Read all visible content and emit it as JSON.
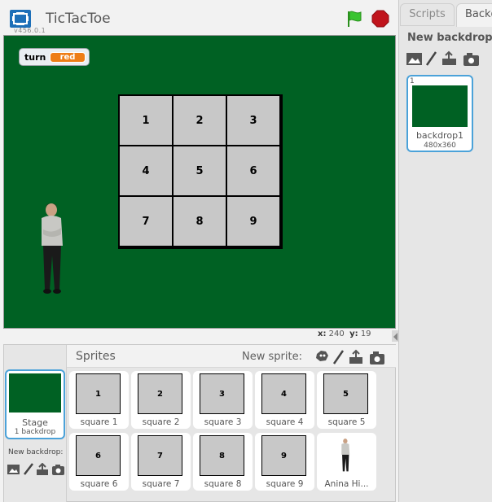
{
  "header": {
    "title": "TicTacToe",
    "version": "v456.0.1"
  },
  "stage": {
    "monitor": {
      "label": "turn",
      "value": "red"
    },
    "board": [
      "1",
      "2",
      "3",
      "4",
      "5",
      "6",
      "7",
      "8",
      "9"
    ],
    "coords": {
      "x_label": "x:",
      "x_value": "240",
      "y_label": "y:",
      "y_value": "19"
    }
  },
  "sprites_pane": {
    "title": "Sprites",
    "new_sprite_label": "New sprite:",
    "stage": {
      "label": "Stage",
      "sub": "1 backdrop",
      "new_backdrop_label": "New backdrop:"
    },
    "sprites": [
      {
        "name": "square 1",
        "thumb": "1"
      },
      {
        "name": "square 2",
        "thumb": "2"
      },
      {
        "name": "square 3",
        "thumb": "3"
      },
      {
        "name": "square 4",
        "thumb": "4"
      },
      {
        "name": "square 5",
        "thumb": "5"
      },
      {
        "name": "square 6",
        "thumb": "6"
      },
      {
        "name": "square 7",
        "thumb": "7"
      },
      {
        "name": "square 8",
        "thumb": "8"
      },
      {
        "name": "square 9",
        "thumb": "9"
      },
      {
        "name": "Anina Hi...",
        "thumb": ""
      }
    ]
  },
  "right_panel": {
    "tabs": {
      "scripts": "Scripts",
      "backdrops": "Backdrops"
    },
    "new_backdrop_title": "New backdrop:",
    "backdrop": {
      "index": "1",
      "name": "backdrop1",
      "size": "480x360"
    }
  },
  "colors": {
    "stage_green": "#006123",
    "accent_blue": "#4ba2d9",
    "monitor_orange": "#ee7d16",
    "cell_gray": "#c8c8c8"
  },
  "icons": [
    "fullscreen-icon",
    "green-flag-icon",
    "stop-icon",
    "paint-icon",
    "upload-icon",
    "camera-icon",
    "library-icon",
    "sprite-library-icon"
  ]
}
